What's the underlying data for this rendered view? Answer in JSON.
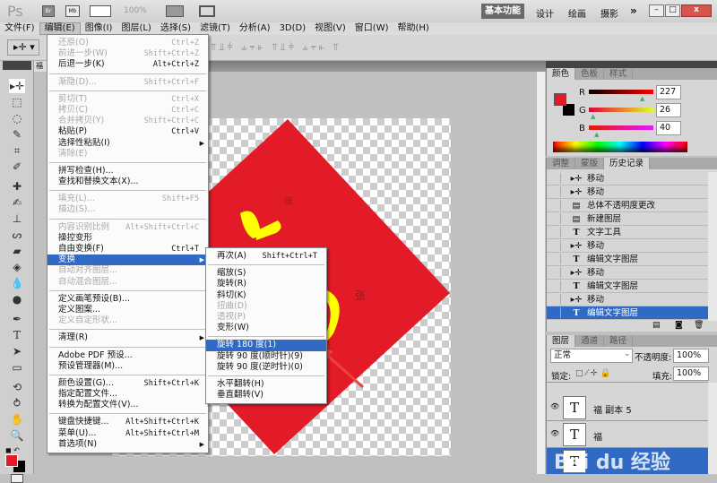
{
  "titlebar": {
    "logo": "Ps",
    "br": "Br",
    "mb": "Mb",
    "zoom": "100%",
    "workspaces": [
      "基本功能",
      "设计",
      "绘画",
      "摄影"
    ],
    "more": "»",
    "active_workspace": "基本功能"
  },
  "menubar": [
    "文件(F)",
    "编辑(E)",
    "图像(I)",
    "图层(L)",
    "选择(S)",
    "滤镜(T)",
    "分析(A)",
    "3D(D)",
    "视图(V)",
    "窗口(W)",
    "帮助(H)"
  ],
  "doc_tab": "福",
  "edit_menu": [
    {
      "l": "还原(O)",
      "s": "Ctrl+Z",
      "d": true
    },
    {
      "l": "前进一步(W)",
      "s": "Shift+Ctrl+Z",
      "d": true
    },
    {
      "l": "后退一步(K)",
      "s": "Alt+Ctrl+Z"
    },
    {
      "sep": true
    },
    {
      "l": "渐隐(D)...",
      "s": "Shift+Ctrl+F",
      "d": true
    },
    {
      "sep": true
    },
    {
      "l": "剪切(T)",
      "s": "Ctrl+X",
      "d": true
    },
    {
      "l": "拷贝(C)",
      "s": "Ctrl+C",
      "d": true
    },
    {
      "l": "合并拷贝(Y)",
      "s": "Shift+Ctrl+C",
      "d": true
    },
    {
      "l": "粘贴(P)",
      "s": "Ctrl+V"
    },
    {
      "l": "选择性粘贴(I)",
      "sub": true
    },
    {
      "l": "清除(E)",
      "d": true
    },
    {
      "sep": true
    },
    {
      "l": "拼写检查(H)..."
    },
    {
      "l": "查找和替换文本(X)..."
    },
    {
      "sep": true
    },
    {
      "l": "填充(L)...",
      "s": "Shift+F5",
      "d": true
    },
    {
      "l": "描边(S)...",
      "d": true
    },
    {
      "sep": true
    },
    {
      "l": "内容识别比例",
      "s": "Alt+Shift+Ctrl+C",
      "d": true
    },
    {
      "l": "操控变形"
    },
    {
      "l": "自由变换(F)",
      "s": "Ctrl+T"
    },
    {
      "l": "变换",
      "sub": true,
      "h": true
    },
    {
      "l": "自动对齐图层...",
      "d": true
    },
    {
      "l": "自动混合图层...",
      "d": true
    },
    {
      "sep": true
    },
    {
      "l": "定义画笔预设(B)..."
    },
    {
      "l": "定义图案..."
    },
    {
      "l": "定义自定形状...",
      "d": true
    },
    {
      "sep": true
    },
    {
      "l": "清理(R)",
      "sub": true
    },
    {
      "sep": true
    },
    {
      "l": "Adobe PDF 预设..."
    },
    {
      "l": "预设管理器(M)..."
    },
    {
      "sep": true
    },
    {
      "l": "颜色设置(G)...",
      "s": "Shift+Ctrl+K"
    },
    {
      "l": "指定配置文件..."
    },
    {
      "l": "转换为配置文件(V)..."
    },
    {
      "sep": true
    },
    {
      "l": "键盘快捷键...",
      "s": "Alt+Shift+Ctrl+K"
    },
    {
      "l": "菜单(U)...",
      "s": "Alt+Shift+Ctrl+M"
    },
    {
      "l": "首选项(N)",
      "sub": true
    }
  ],
  "transform_menu": [
    {
      "l": "再次(A)",
      "s": "Shift+Ctrl+T"
    },
    {
      "sep": true
    },
    {
      "l": "缩放(S)"
    },
    {
      "l": "旋转(R)"
    },
    {
      "l": "斜切(K)"
    },
    {
      "l": "扭曲(D)",
      "d": true
    },
    {
      "l": "透视(P)",
      "d": true
    },
    {
      "l": "变形(W)"
    },
    {
      "sep": true
    },
    {
      "l": "旋转 180 度(1)",
      "h": true
    },
    {
      "l": "旋转 90 度(顺时针)(9)"
    },
    {
      "l": "旋转 90 度(逆时针)(0)"
    },
    {
      "sep": true
    },
    {
      "l": "水平翻转(H)"
    },
    {
      "l": "垂直翻转(V)"
    }
  ],
  "color_panel": {
    "tabs": [
      "颜色",
      "色板",
      "样式"
    ],
    "r_label": "R",
    "g_label": "G",
    "b_label": "B",
    "r": "227",
    "g": "26",
    "b": "40",
    "fg": "#e31a28",
    "bg": "#000000"
  },
  "history_panel": {
    "tabs": [
      "调整",
      "蒙版",
      "历史记录"
    ],
    "items": [
      {
        "icon": "move",
        "l": "移动"
      },
      {
        "icon": "move",
        "l": "移动"
      },
      {
        "icon": "doc",
        "l": "总体不透明度更改"
      },
      {
        "icon": "doc",
        "l": "新建图层"
      },
      {
        "icon": "text",
        "l": "文字工具"
      },
      {
        "icon": "move",
        "l": "移动"
      },
      {
        "icon": "text",
        "l": "编辑文字图层"
      },
      {
        "icon": "move",
        "l": "移动"
      },
      {
        "icon": "text",
        "l": "编辑文字图层"
      },
      {
        "icon": "move",
        "l": "移动"
      },
      {
        "icon": "text",
        "l": "编辑文字图层",
        "sel": true
      }
    ]
  },
  "layers_panel": {
    "tabs": [
      "图层",
      "通道",
      "路径"
    ],
    "blend": "正常",
    "opacity_label": "不透明度:",
    "opacity": "100%",
    "lock_label": "锁定:",
    "fill_label": "填充:",
    "fill": "100%",
    "layers": [
      {
        "name": "福 副本 5"
      },
      {
        "name": "福"
      }
    ]
  },
  "watermark": "Bai du 经验",
  "colors": {
    "accent": "#316ac5",
    "red": "#e31a28",
    "yellow": "#ffff00"
  }
}
